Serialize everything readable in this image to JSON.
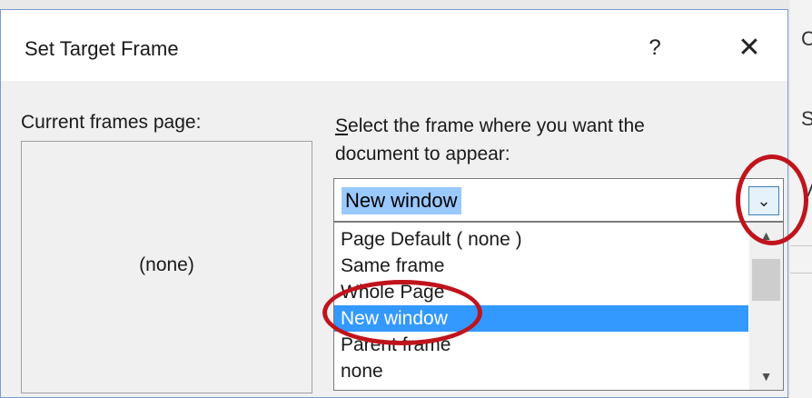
{
  "dialog": {
    "title": "Set Target Frame",
    "help_label": "?",
    "close_label": "✕"
  },
  "left": {
    "label": "Current frames page:",
    "preview_text": "(none)"
  },
  "right": {
    "label_first_letter": "S",
    "label_line1_rest": "elect the frame where you want the",
    "label_line2": "document to appear:"
  },
  "combo": {
    "value": "New window",
    "arrow_glyph": "⌄"
  },
  "list": {
    "items": [
      "Page Default ( none )",
      "Same frame",
      "Whole Page",
      "New window",
      "Parent frame",
      "none"
    ],
    "selected_index": 3
  },
  "scrollbar": {
    "up_glyph": "▲",
    "down_glyph": "▼"
  },
  "background_window": {
    "fragments": [
      "C",
      "S",
      "V"
    ]
  },
  "annotation_color": "#c0141c"
}
